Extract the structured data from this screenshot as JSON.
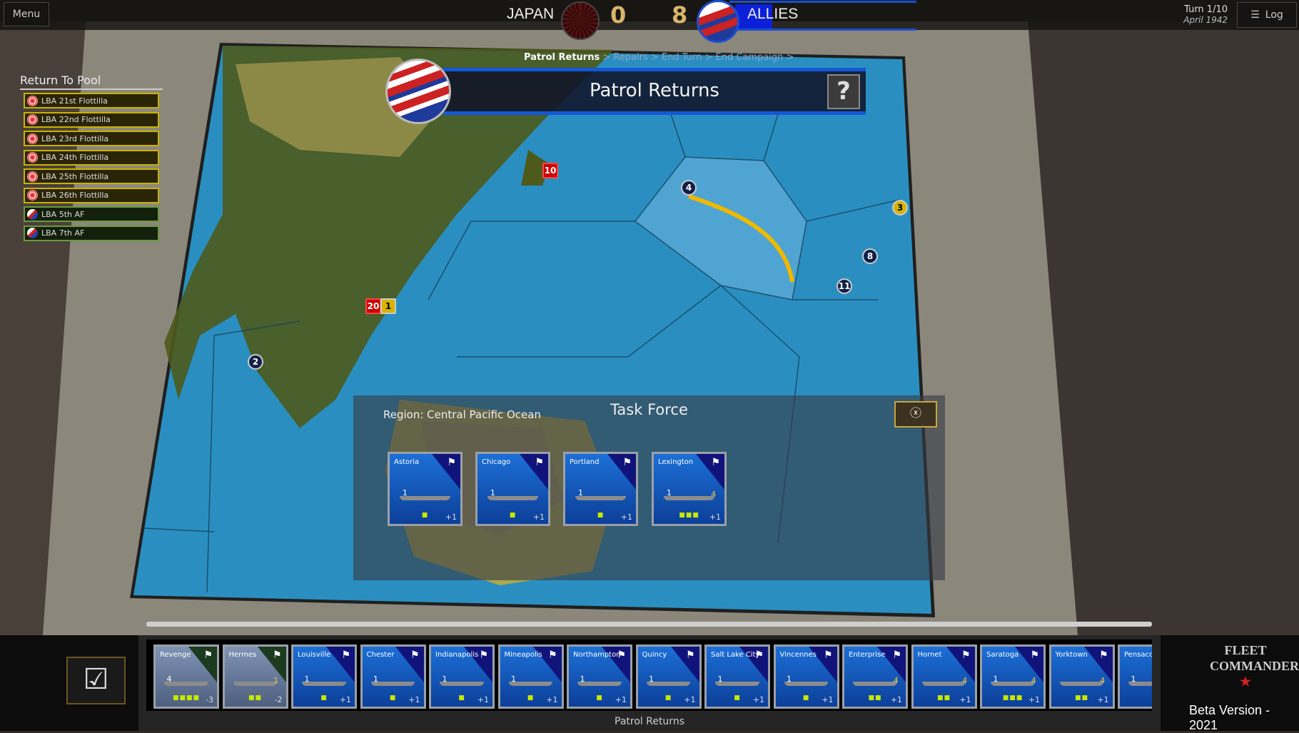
{
  "topbar": {
    "menu_label": "Menu",
    "japan_label": "JAPAN",
    "japan_score": "0",
    "allies_score": "8",
    "allies_label": "ALLIES",
    "turn": "Turn 1/10",
    "date": "April 1942",
    "log_label": "Log",
    "log_icon": "hamburger-icon"
  },
  "colors": {
    "allies_blue": "#1457d8",
    "japan_pool": "#c9b200",
    "allies_pool": "#6a9a3c",
    "ocean": "#2a8fc0"
  },
  "pool": {
    "title": "Return To Pool",
    "items": [
      {
        "label": "LBA 21st Flottilla",
        "side": "japan"
      },
      {
        "label": "LBA 22nd Flottilla",
        "side": "japan"
      },
      {
        "label": "LBA 23rd Flottilla",
        "side": "japan"
      },
      {
        "label": "LBA 24th Flottilla",
        "side": "japan"
      },
      {
        "label": "LBA 25th Flottilla",
        "side": "japan"
      },
      {
        "label": "LBA 26th Flottilla",
        "side": "japan"
      },
      {
        "label": "LBA 5th AF",
        "side": "allies"
      },
      {
        "label": "LBA 7th AF",
        "side": "allies"
      }
    ]
  },
  "phase": {
    "breadcrumb": [
      "Patrol Returns",
      "Repairs",
      "End Turn",
      "End Campaign"
    ],
    "title": "Patrol Returns",
    "help_label": "?"
  },
  "map": {
    "markers": [
      "4",
      "11",
      "2",
      "20",
      "1",
      "10",
      "8",
      "3"
    ]
  },
  "task_force": {
    "title": "Task Force",
    "region": "Region: Central Pacific Ocean",
    "close_icon": "close-icon",
    "ships": [
      {
        "name": "Astoria",
        "gun": "1",
        "air": "",
        "pips": "■",
        "mod": "+1"
      },
      {
        "name": "Chicago",
        "gun": "1",
        "air": "",
        "pips": "■",
        "mod": "+1"
      },
      {
        "name": "Portland",
        "gun": "1",
        "air": "",
        "pips": "■",
        "mod": "+1"
      },
      {
        "name": "Lexington",
        "gun": "1",
        "air": "4",
        "pips": "■■■",
        "mod": "+1"
      }
    ]
  },
  "fleet": {
    "label": "Patrol Returns",
    "ships": [
      {
        "name": "Revenge",
        "gun": "4",
        "air": "",
        "pips": "■■■■",
        "mod": "-3",
        "side": "uk"
      },
      {
        "name": "Hermes",
        "gun": "",
        "air": "1",
        "pips": "■■",
        "mod": "-2",
        "side": "uk"
      },
      {
        "name": "Louisville",
        "gun": "1",
        "air": "",
        "pips": "■",
        "mod": "+1",
        "side": "us"
      },
      {
        "name": "Chester",
        "gun": "1",
        "air": "",
        "pips": "■",
        "mod": "+1",
        "side": "us"
      },
      {
        "name": "Indianapolis",
        "gun": "1",
        "air": "",
        "pips": "■",
        "mod": "+1",
        "side": "us"
      },
      {
        "name": "Mineapolis",
        "gun": "1",
        "air": "",
        "pips": "■",
        "mod": "+1",
        "side": "us"
      },
      {
        "name": "Northampton",
        "gun": "1",
        "air": "",
        "pips": "■",
        "mod": "+1",
        "side": "us"
      },
      {
        "name": "Quincy",
        "gun": "1",
        "air": "",
        "pips": "■",
        "mod": "+1",
        "side": "us"
      },
      {
        "name": "Salt Lake City",
        "gun": "1",
        "air": "",
        "pips": "■",
        "mod": "+1",
        "side": "us"
      },
      {
        "name": "Vincennes",
        "gun": "1",
        "air": "",
        "pips": "■",
        "mod": "+1",
        "side": "us"
      },
      {
        "name": "Enterprise",
        "gun": "",
        "air": "4",
        "pips": "■■",
        "mod": "+1",
        "side": "us"
      },
      {
        "name": "Hornet",
        "gun": "",
        "air": "4",
        "pips": "■■",
        "mod": "+1",
        "side": "us"
      },
      {
        "name": "Saratoga",
        "gun": "1",
        "air": "4",
        "pips": "■■■",
        "mod": "+1",
        "side": "us"
      },
      {
        "name": "Yorktown",
        "gun": "",
        "air": "4",
        "pips": "■■",
        "mod": "+1",
        "side": "us"
      },
      {
        "name": "Pensacola",
        "gun": "1",
        "air": "",
        "pips": "",
        "mod": "",
        "side": "us"
      }
    ]
  },
  "branding": {
    "logo": "FLEET COMMANDER NIMITZ",
    "beta": "Beta Version - 2021"
  }
}
